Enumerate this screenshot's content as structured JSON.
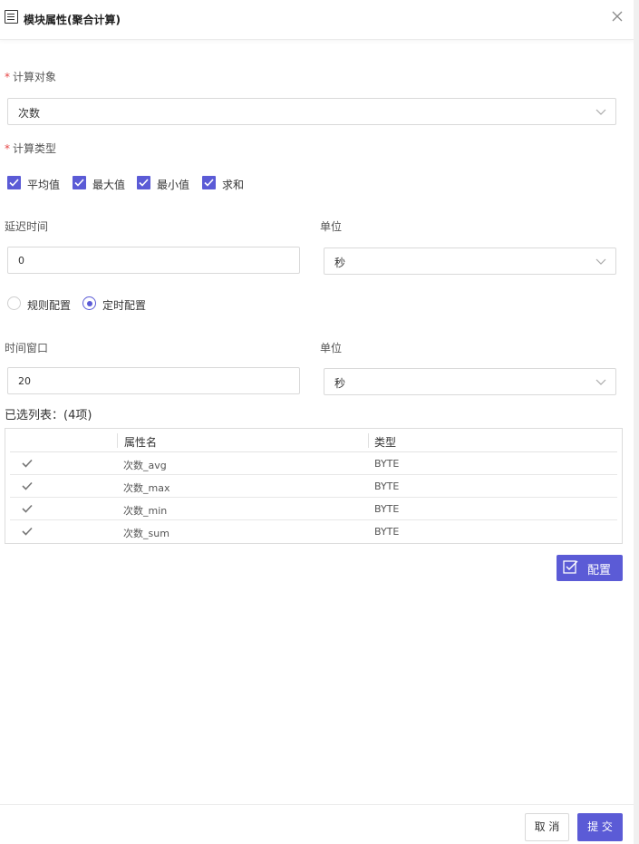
{
  "header": {
    "title": "模块属性(聚合计算)",
    "icon": "list-icon",
    "close_icon": "close-icon",
    "close_label": "X"
  },
  "calc_object": {
    "label": "计算对象",
    "required_mark": "*",
    "value": "次数"
  },
  "calc_type": {
    "label": "计算类型",
    "required_mark": "*",
    "options": [
      {
        "label": "平均值",
        "checked": true
      },
      {
        "label": "最大值",
        "checked": true
      },
      {
        "label": "最小值",
        "checked": true
      },
      {
        "label": "求和",
        "checked": true
      }
    ]
  },
  "delay": {
    "label": "延迟时间",
    "value": "0",
    "unit_label": "单位",
    "unit_value": "秒"
  },
  "mode": {
    "options": [
      {
        "label": "规则配置",
        "selected": false
      },
      {
        "label": "定时配置",
        "selected": true
      }
    ]
  },
  "window": {
    "label": "时间窗口",
    "value": "20",
    "unit_label": "单位",
    "unit_value": "秒"
  },
  "selected_list": {
    "title": "已选列表：(4项)",
    "columns": [
      "属性名",
      "类型"
    ],
    "rows": [
      {
        "name": "次数_avg",
        "type": "BYTE"
      },
      {
        "name": "次数_max",
        "type": "BYTE"
      },
      {
        "name": "次数_min",
        "type": "BYTE"
      },
      {
        "name": "次数_sum",
        "type": "BYTE"
      }
    ]
  },
  "config_button": {
    "label": "配置"
  },
  "footer": {
    "cancel_label": "取 消",
    "submit_label": "提 交"
  },
  "colors": {
    "accent": "#5b5bd6",
    "required": "#e64545",
    "border": "#d9d9d9"
  }
}
